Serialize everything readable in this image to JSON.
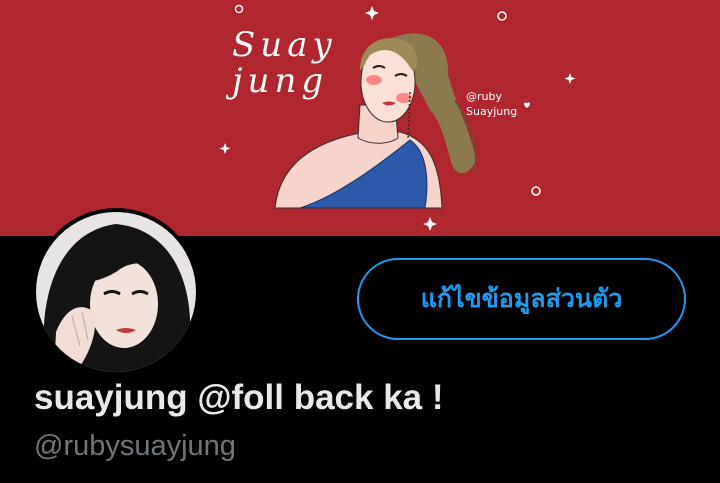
{
  "banner": {
    "title_line1": "Suay",
    "title_line2": "jung",
    "handle_line1": "@ruby",
    "handle_line2": "Suayjung",
    "background_color": "#b0262f"
  },
  "profile": {
    "avatar_icon": "profile-photo",
    "edit_button_label": "แก้ไขข้อมูลส่วนตัว",
    "display_name": "suayjung @foll back ka !",
    "username": "@rubysuayjung",
    "accent_color": "#1d9bf0"
  }
}
